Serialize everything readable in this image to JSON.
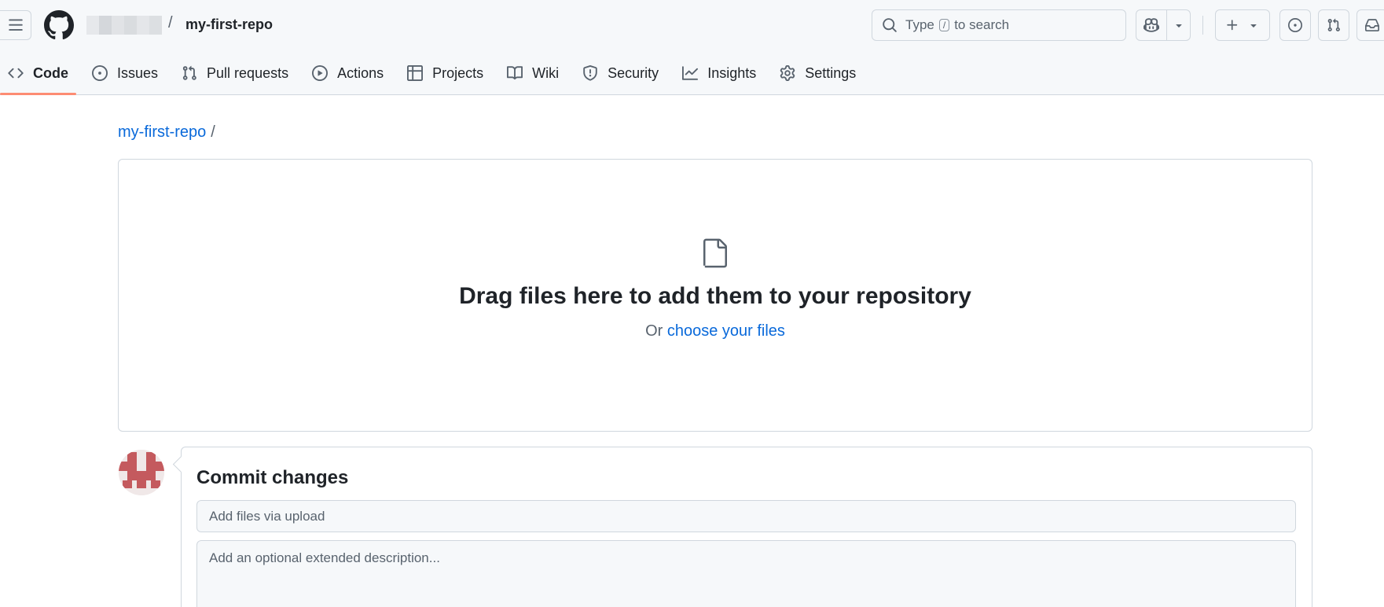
{
  "header": {
    "repo_name": "my-first-repo",
    "path_separator": "/",
    "search": {
      "prefix": "Type",
      "key": "/",
      "suffix": "to search"
    }
  },
  "icons": {
    "menu": "hamburger-icon",
    "logo": "github-logo-icon",
    "search": "search-icon",
    "copilot": "copilot-icon",
    "plus": "plus-icon",
    "issues": "issue-opened-icon",
    "pulls": "git-pull-request-icon",
    "inbox": "inbox-icon",
    "file": "file-icon"
  },
  "tabs": [
    {
      "label": "Code",
      "icon": "code-icon",
      "active": true
    },
    {
      "label": "Issues",
      "icon": "issue-opened-icon",
      "active": false
    },
    {
      "label": "Pull requests",
      "icon": "git-pull-request-icon",
      "active": false
    },
    {
      "label": "Actions",
      "icon": "play-icon",
      "active": false
    },
    {
      "label": "Projects",
      "icon": "table-icon",
      "active": false
    },
    {
      "label": "Wiki",
      "icon": "book-icon",
      "active": false
    },
    {
      "label": "Security",
      "icon": "shield-icon",
      "active": false
    },
    {
      "label": "Insights",
      "icon": "graph-icon",
      "active": false
    },
    {
      "label": "Settings",
      "icon": "gear-icon",
      "active": false
    }
  ],
  "main": {
    "breadcrumb": {
      "repo": "my-first-repo",
      "separator": "/"
    },
    "dropzone": {
      "title": "Drag files here to add them to your repository",
      "or_text": "Or",
      "choose_link": "choose your files"
    },
    "commit": {
      "title": "Commit changes",
      "summary_placeholder": "Add files via upload",
      "description_placeholder": "Add an optional extended description..."
    }
  },
  "colors": {
    "accent_link": "#0969da",
    "active_tab_underline": "#fd8c73",
    "header_bg": "#f6f8fa",
    "border": "#d0d7de",
    "avatar": "#c45a5e"
  }
}
